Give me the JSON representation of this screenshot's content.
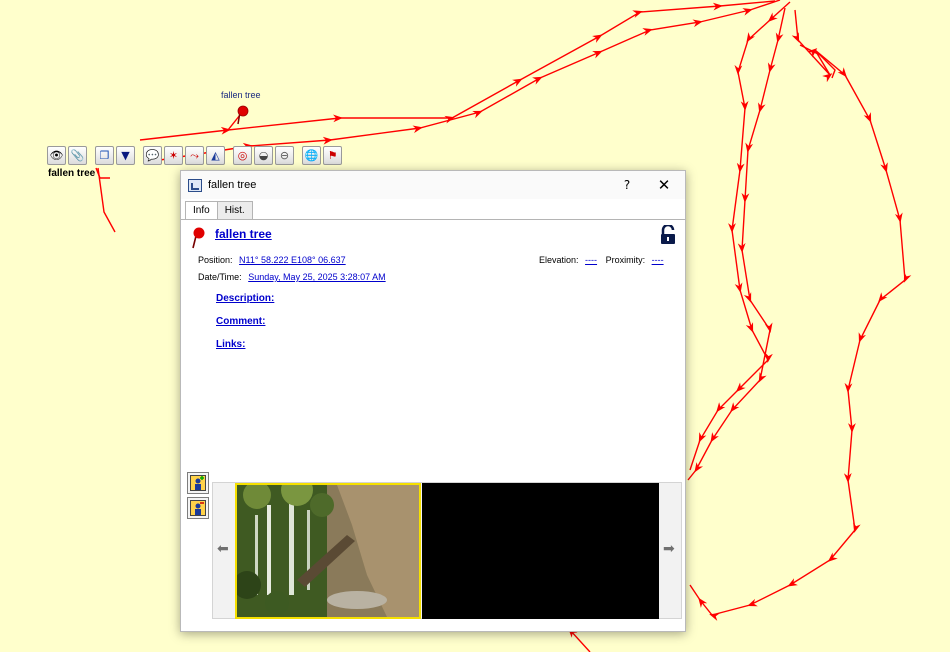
{
  "map": {
    "waypoint_label": "fallen tree",
    "selected_label": "fallen tree",
    "track_color": "#ff0000",
    "background_color": "#ffffcc"
  },
  "toolbar": {
    "icons": [
      "eye-icon",
      "paperclip-icon",
      "copy-icon",
      "bucket-icon",
      "comment-icon",
      "star-flag-icon",
      "route-icon",
      "profile-icon",
      "target-icon",
      "basket-icon",
      "minus-icon",
      "globe-pin-icon",
      "flag-icon"
    ]
  },
  "dialog": {
    "title": "fallen tree",
    "help_label": "?",
    "close_label": "✕",
    "tabs": [
      {
        "label": "Info",
        "active": true
      },
      {
        "label": "Hist.",
        "active": false
      }
    ],
    "info": {
      "name": "fallen tree",
      "position_label": "Position:",
      "position_value": "N11° 58.222 E108° 06.637",
      "elevation_label": "Elevation:",
      "elevation_value": "----",
      "proximity_label": "Proximity:",
      "proximity_value": "----",
      "datetime_label": "Date/Time:",
      "datetime_value": "Sunday, May 25, 2025 3:28:07 AM",
      "description_label": "Description:",
      "comment_label": "Comment:",
      "links_label": "Links:"
    },
    "gallery": {
      "prev_label": "⬅",
      "next_label": "➡"
    }
  }
}
